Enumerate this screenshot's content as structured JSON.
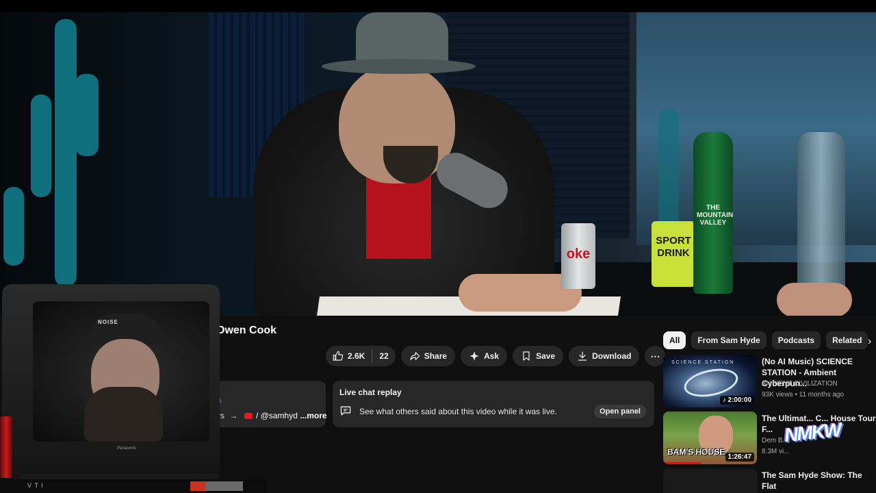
{
  "video": {
    "title": "Owen Cook",
    "overlays": {
      "can_brand": "oke",
      "sport_drink": "SPORT DRINK",
      "bottle_label": "THE MOUNTAIN VALLEY"
    }
  },
  "actions": {
    "like_count": "2.6K",
    "dislike_count": "22",
    "share_label": "Share",
    "ask_label": "Ask",
    "save_label": "Save",
    "download_label": "Download",
    "more_label": "⋯"
  },
  "description": {
    "partial_top": "s",
    "partial_line": "rs",
    "handle": "/ @samhyd",
    "more_label": "...more"
  },
  "live_chat": {
    "title": "Live chat replay",
    "text": "See what others said about this video while it was live.",
    "open_label": "Open panel"
  },
  "chips": [
    "All",
    "From Sam Hyde",
    "Podcasts",
    "Related"
  ],
  "chips_next_icon": "chevron-right-icon",
  "recommendations": [
    {
      "title": "(No AI Music) SCIENCE STATION - Ambient Cyberpun...",
      "channel": "AMBIENT CIVILIZATION",
      "meta": "93K views • 11 months ago",
      "duration": "2:00:00",
      "thumb_label": "SCIENCE STATION"
    },
    {
      "title": "The Ultimat... C... House Tour F...",
      "channel": "Dem B...",
      "meta": "8.3M vi...",
      "duration": "1:26:47",
      "thumb_label": "BAM'S HOUSE"
    },
    {
      "title": "The Sam Hyde Show: The Flat"
    }
  ],
  "webcam": {
    "cap_text": "NOISE",
    "tv_brand": "Panasonic",
    "strip_text": "V T I"
  },
  "colors": {
    "background": "#0f0f0f",
    "pill": "#272727",
    "accent_red": "#ff0000",
    "link_blue": "#3ea6ff"
  }
}
